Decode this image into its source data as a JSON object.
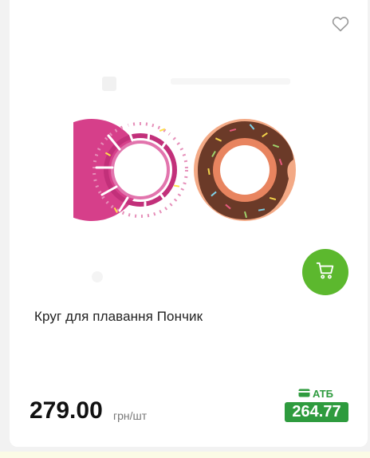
{
  "product": {
    "title": "Круг для плавання Пончик",
    "price": "279.00",
    "unit": "грн/шт",
    "promo_label": "АТБ",
    "promo_price": "264.77"
  },
  "icons": {
    "favorite": "heart-outline-icon",
    "cart": "shopping-cart-icon",
    "promo": "card-icon"
  },
  "colors": {
    "accent_green": "#5cb82e",
    "promo_green": "#2e9b3e"
  }
}
